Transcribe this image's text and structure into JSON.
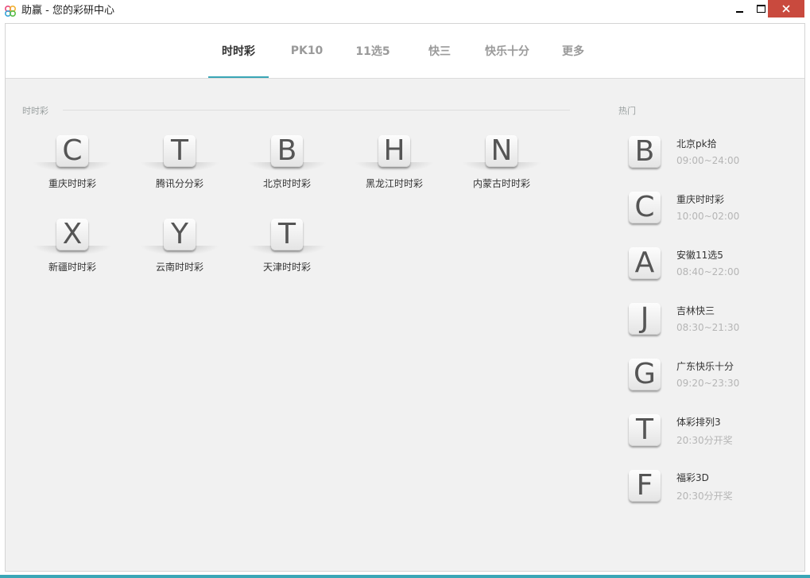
{
  "window": {
    "title": "助赢 - 您的彩研中心"
  },
  "nav": {
    "tabs": [
      {
        "label": "时时彩",
        "active": true
      },
      {
        "label": "PK10",
        "active": false
      },
      {
        "label": "11选5",
        "active": false
      },
      {
        "label": "快三",
        "active": false
      },
      {
        "label": "快乐十分",
        "active": false
      },
      {
        "label": "更多",
        "active": false
      }
    ]
  },
  "section": {
    "title": "时时彩",
    "lotteries": [
      {
        "letter": "C",
        "name": "重庆时时彩"
      },
      {
        "letter": "T",
        "name": "腾讯分分彩"
      },
      {
        "letter": "B",
        "name": "北京时时彩"
      },
      {
        "letter": "H",
        "name": "黑龙江时时彩"
      },
      {
        "letter": "N",
        "name": "内蒙古时时彩"
      },
      {
        "letter": "X",
        "name": "新疆时时彩"
      },
      {
        "letter": "Y",
        "name": "云南时时彩"
      },
      {
        "letter": "T",
        "name": "天津时时彩"
      }
    ]
  },
  "hot": {
    "title": "热门",
    "items": [
      {
        "letter": "B",
        "name": "北京pk拾",
        "time": "09:00~24:00"
      },
      {
        "letter": "C",
        "name": "重庆时时彩",
        "time": "10:00~02:00"
      },
      {
        "letter": "A",
        "name": "安徽11选5",
        "time": "08:40~22:00"
      },
      {
        "letter": "J",
        "name": "吉林快三",
        "time": "08:30~21:30"
      },
      {
        "letter": "G",
        "name": "广东快乐十分",
        "time": "09:20~23:30"
      },
      {
        "letter": "T",
        "name": "体彩排列3",
        "time": "20:30分开奖"
      },
      {
        "letter": "F",
        "name": "福彩3D",
        "time": "20:30分开奖"
      }
    ]
  },
  "colors": {
    "accent": "#3aa6b6",
    "close_button": "#c94a3e",
    "content_background": "#f1f1f1"
  }
}
